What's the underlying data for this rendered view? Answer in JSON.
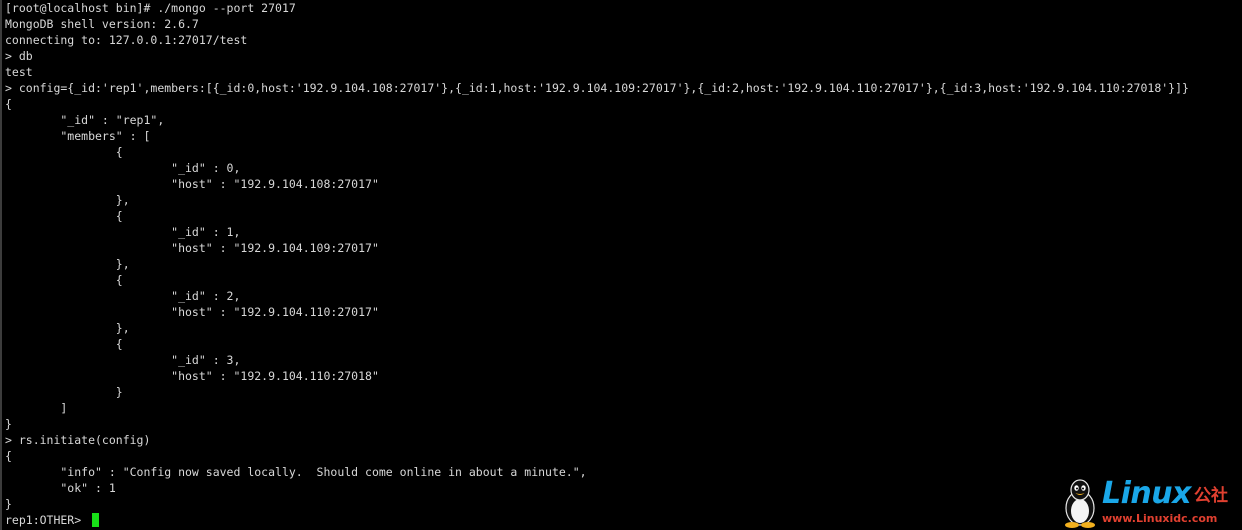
{
  "terminal": {
    "lines": [
      "[root@localhost bin]# ./mongo --port 27017",
      "MongoDB shell version: 2.6.7",
      "connecting to: 127.0.0.1:27017/test",
      "> db",
      "test",
      "> config={_id:'rep1',members:[{_id:0,host:'192.9.104.108:27017'},{_id:1,host:'192.9.104.109:27017'},{_id:2,host:'192.9.104.110:27017'},{_id:3,host:'192.9.104.110:27018'}]}",
      "{",
      "        \"_id\" : \"rep1\",",
      "        \"members\" : [",
      "                {",
      "                        \"_id\" : 0,",
      "                        \"host\" : \"192.9.104.108:27017\"",
      "                },",
      "                {",
      "                        \"_id\" : 1,",
      "                        \"host\" : \"192.9.104.109:27017\"",
      "                },",
      "                {",
      "                        \"_id\" : 2,",
      "                        \"host\" : \"192.9.104.110:27017\"",
      "                },",
      "                {",
      "                        \"_id\" : 3,",
      "                        \"host\" : \"192.9.104.110:27018\"",
      "                }",
      "        ]",
      "}",
      "> rs.initiate(config)",
      "{",
      "        \"info\" : \"Config now saved locally.  Should come online in about a minute.\",",
      "        \"ok\" : 1",
      "}"
    ],
    "prompt": "rep1:OTHER> ",
    "colors": {
      "background": "#000000",
      "text": "#d8d8d8",
      "cursor": "#18e018"
    }
  },
  "watermark": {
    "brand": "Linux",
    "brand_cn": "公社",
    "url": "www.Linuxidc.com",
    "icon": "tux-penguin-icon"
  }
}
